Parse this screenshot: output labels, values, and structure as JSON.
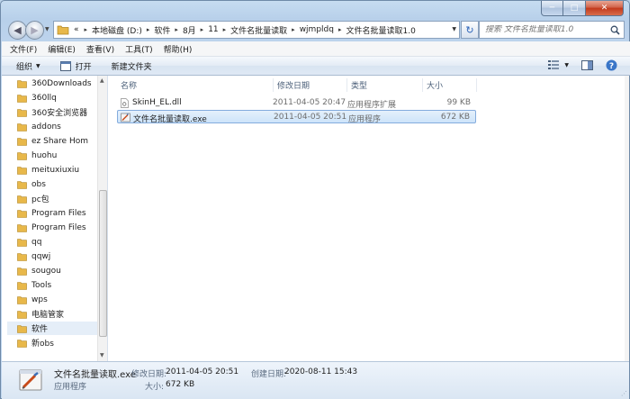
{
  "window": {
    "caption": {
      "minimize_glyph": "─",
      "maximize_glyph": "□",
      "close_glyph": "✕"
    }
  },
  "address_bar": {
    "overflow_glyph": "«",
    "breadcrumbs": [
      "本地磁盘 (D:)",
      "软件",
      "8月",
      "11",
      "文件名批量读取",
      "wjmpldq",
      "文件名批量读取1.0"
    ]
  },
  "search": {
    "placeholder": "搜索 文件名批量读取1.0"
  },
  "menubar": {
    "items": [
      "文件(F)",
      "编辑(E)",
      "查看(V)",
      "工具(T)",
      "帮助(H)"
    ]
  },
  "toolbar": {
    "organize": "组织",
    "open": "打开",
    "new_folder": "新建文件夹"
  },
  "nav_pane": {
    "items": [
      "360Downloads",
      "360llq",
      "360安全浏览器",
      "addons",
      "ez Share Hom",
      "huohu",
      "meituxiuxiu",
      "obs",
      "pc包",
      "Program Files",
      "Program Files",
      "qq",
      "qqwj",
      "sougou",
      "Tools",
      "wps",
      "电脑管家",
      "软件",
      "新obs"
    ],
    "selected_index": 17
  },
  "columns": {
    "name": "名称",
    "date": "修改日期",
    "type": "类型",
    "size": "大小"
  },
  "files": [
    {
      "name": "SkinH_EL.dll",
      "date": "2011-04-05 20:47",
      "type": "应用程序扩展",
      "size": "99 KB",
      "icon": "dll-icon"
    },
    {
      "name": "文件名批量读取.exe",
      "date": "2011-04-05 20:51",
      "type": "应用程序",
      "size": "672 KB",
      "icon": "exe-icon"
    }
  ],
  "details": {
    "file_name": "文件名批量读取.exe",
    "file_type": "应用程序",
    "modified_label": "修改日期:",
    "modified_value": "2011-04-05 20:51",
    "created_label": "创建日期:",
    "created_value": "2020-08-11 15:43",
    "size_label": "大小:",
    "size_value": "672 KB"
  },
  "colors": {
    "selection_border": "#84acdd",
    "folder_yellow": "#e8b84a",
    "accent_blue": "#2a62b8"
  }
}
